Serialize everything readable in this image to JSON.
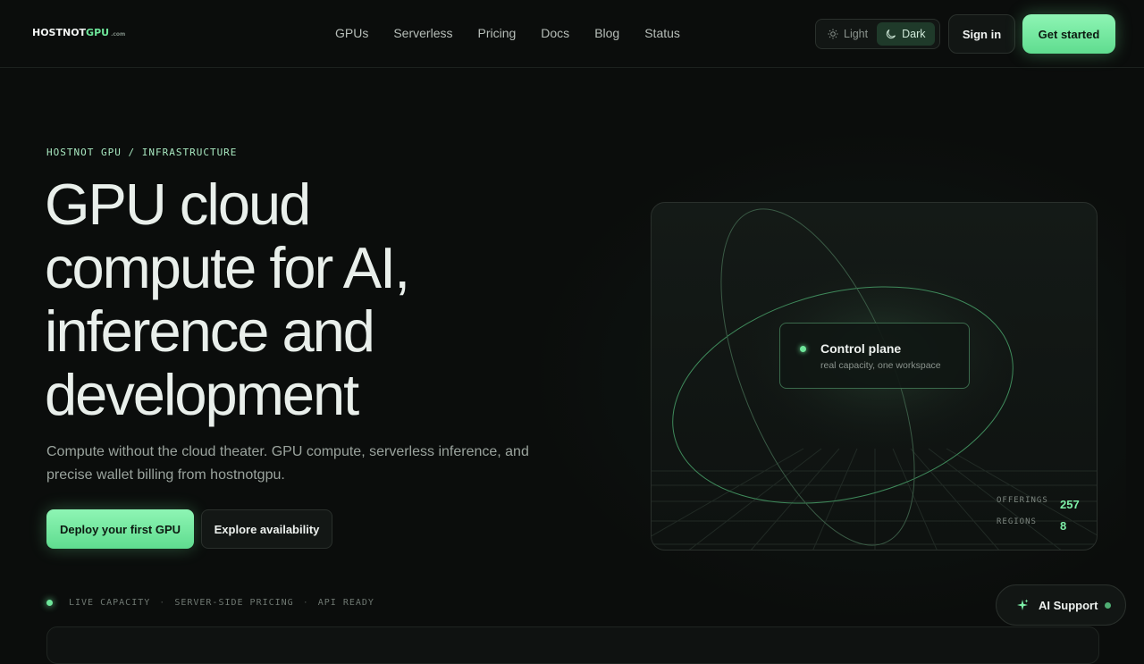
{
  "brand": {
    "logo_main": "HOSTNOT",
    "logo_accent": "GPU",
    "logo_tld": ".com"
  },
  "nav": {
    "items": [
      "GPUs",
      "Serverless",
      "Pricing",
      "Docs",
      "Blog",
      "Status"
    ]
  },
  "theme": {
    "light_label": "Light",
    "dark_label": "Dark",
    "selected": "Dark",
    "light_icon": "sun-icon",
    "dark_icon": "moon-icon"
  },
  "header": {
    "signin_label": "Sign in",
    "cta_label": "Get started"
  },
  "hero": {
    "eyebrow": "HOSTNOT GPU / INFRASTRUCTURE",
    "title_lines": [
      "GPU cloud",
      "compute for AI,",
      "inference and",
      "development"
    ],
    "subtitle": "Compute without the cloud theater. GPU compute, serverless inference, and precise wallet billing from hostnotgpu.",
    "primary_button": "Deploy your first GPU",
    "secondary_button": "Explore availability"
  },
  "status_strip": {
    "items": [
      "LIVE CAPACITY",
      "SERVER-SIDE PRICING",
      "API READY"
    ],
    "separator": "·"
  },
  "panel": {
    "card_title": "Control plane",
    "card_subtitle": "real capacity, one workspace",
    "stats": [
      {
        "label": "OFFERINGS",
        "value": "257"
      },
      {
        "label": "REGIONS",
        "value": "8"
      }
    ]
  },
  "ai_support": {
    "label": "AI Support",
    "icon": "sparkle-icon"
  },
  "colors": {
    "accent": "#6ee69a",
    "background": "#0b0d0c",
    "panel_border": "#2a302c"
  }
}
